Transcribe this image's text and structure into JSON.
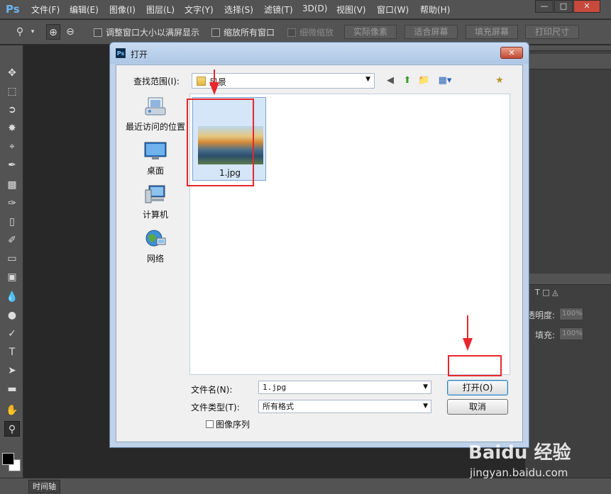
{
  "app": {
    "logo": "Ps"
  },
  "menu": [
    "文件(F)",
    "编辑(E)",
    "图像(I)",
    "图层(L)",
    "文字(Y)",
    "选择(S)",
    "滤镜(T)",
    "3D(D)",
    "视图(V)",
    "窗口(W)",
    "帮助(H)"
  ],
  "window_controls": {
    "minimize": "—",
    "restore": "□",
    "close": "✕"
  },
  "options_bar": {
    "resize_windows": "调整窗口大小以满屏显示",
    "zoom_all": "缩放所有窗口",
    "scrubby_zoom": "细微缩放",
    "actual_pixels": "实际像素",
    "fit_screen": "适合屏幕",
    "fill_screen": "填充屏幕",
    "print_size": "打印尺寸"
  },
  "panels": {
    "opacity_label": "透明度:",
    "opacity_value": "100%",
    "fill_label": "填充:",
    "fill_value": "100%"
  },
  "timeline_tab": "时间轴",
  "dialog": {
    "title": "打开",
    "close": "✕",
    "look_in_label": "查找范围(I):",
    "look_in_value": "风景",
    "places": [
      {
        "label": "最近访问的位置"
      },
      {
        "label": "桌面"
      },
      {
        "label": "计算机"
      },
      {
        "label": "网络"
      }
    ],
    "files": [
      {
        "name": "1.jpg"
      }
    ],
    "filename_label": "文件名(N):",
    "filename_value": "1.jpg",
    "filetype_label": "文件类型(T):",
    "filetype_value": "所有格式",
    "open_button": "打开(O)",
    "cancel_button": "取消",
    "image_sequence": "图像序列"
  },
  "watermark": {
    "logo": "Baidu 经验",
    "url": "jingyan.baidu.com"
  }
}
